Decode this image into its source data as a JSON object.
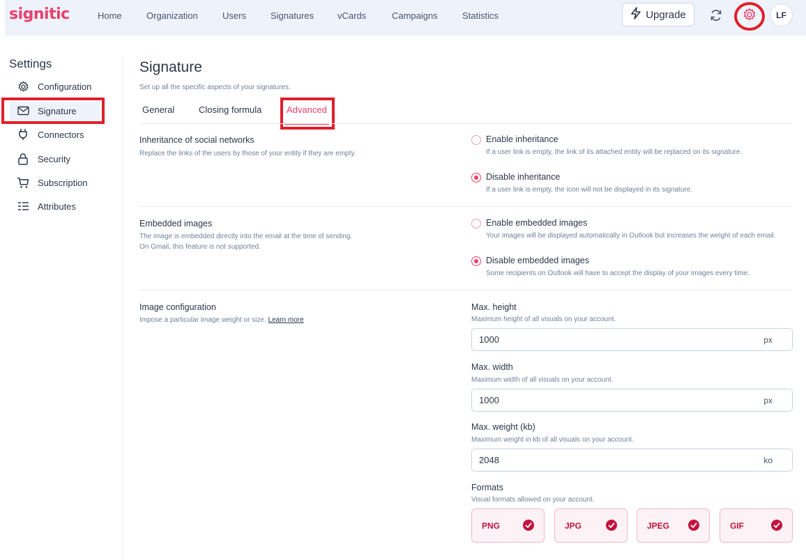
{
  "brand": {
    "logo_text": "signitic",
    "accent": "#e8416b",
    "highlight": "#e01f2a"
  },
  "nav": {
    "items": [
      "Home",
      "Organization",
      "Users",
      "Signatures",
      "vCards",
      "Campaigns",
      "Statistics"
    ],
    "upgrade_label": "Upgrade",
    "avatar_initials": "LF"
  },
  "sidebar": {
    "title": "Settings",
    "items": [
      {
        "label": "Configuration",
        "icon": "gear-icon"
      },
      {
        "label": "Signature",
        "icon": "envelope-icon"
      },
      {
        "label": "Connectors",
        "icon": "plug-icon"
      },
      {
        "label": "Security",
        "icon": "lock-icon"
      },
      {
        "label": "Subscription",
        "icon": "cart-icon"
      },
      {
        "label": "Attributes",
        "icon": "list-icon"
      }
    ],
    "active": "Signature"
  },
  "main": {
    "title": "Signature",
    "subtitle": "Set up all the specific aspects of your signatures.",
    "tabs": [
      "General",
      "Closing formula",
      "Advanced"
    ],
    "active_tab": "Advanced",
    "sections": [
      {
        "title": "Inheritance of social networks",
        "desc": [
          "Replace the links of the users by those of your entity if they are empty."
        ],
        "options": [
          {
            "label": "Enable inheritance",
            "help": "If a user link is empty, the link of its attached entity will be replaced on its signature.",
            "checked": false
          },
          {
            "label": "Disable inheritance",
            "help": "If a user link is empty, the icon will not be displayed in its signature.",
            "checked": true
          }
        ]
      },
      {
        "title": "Embedded images",
        "desc": [
          "The image is embedded directly into the email at the time of sending.",
          "On Gmail, this feature is not supported."
        ],
        "options": [
          {
            "label": "Enable embedded images",
            "help": "Your images will be displayed automatically in Outlook but increases the weight of each email.",
            "checked": false
          },
          {
            "label": "Disable embedded images",
            "help": "Some recipients on Outlook will have to accept the display of your images every time.",
            "checked": true
          }
        ]
      },
      {
        "title": "Image configuration",
        "desc": [
          "Impose a particular image weight or size."
        ],
        "learn_more": "Learn more",
        "fields": [
          {
            "label": "Max. height",
            "help": "Maximum height of all visuals on your account.",
            "value": "1000",
            "unit": "px"
          },
          {
            "label": "Max. width",
            "help": "Maximum width of all visuals on your account.",
            "value": "1000",
            "unit": "px"
          },
          {
            "label": "Max. weight (kb)",
            "help": "Maximum weight in kb of all visuals on your account.",
            "value": "2048",
            "unit": "ko"
          }
        ],
        "formats_label": "Formats",
        "formats_help": "Visual formats allowed on your account.",
        "formats": [
          {
            "label": "PNG",
            "selected": true
          },
          {
            "label": "JPG",
            "selected": true
          },
          {
            "label": "JPEG",
            "selected": true
          },
          {
            "label": "GIF",
            "selected": true
          }
        ]
      }
    ]
  }
}
